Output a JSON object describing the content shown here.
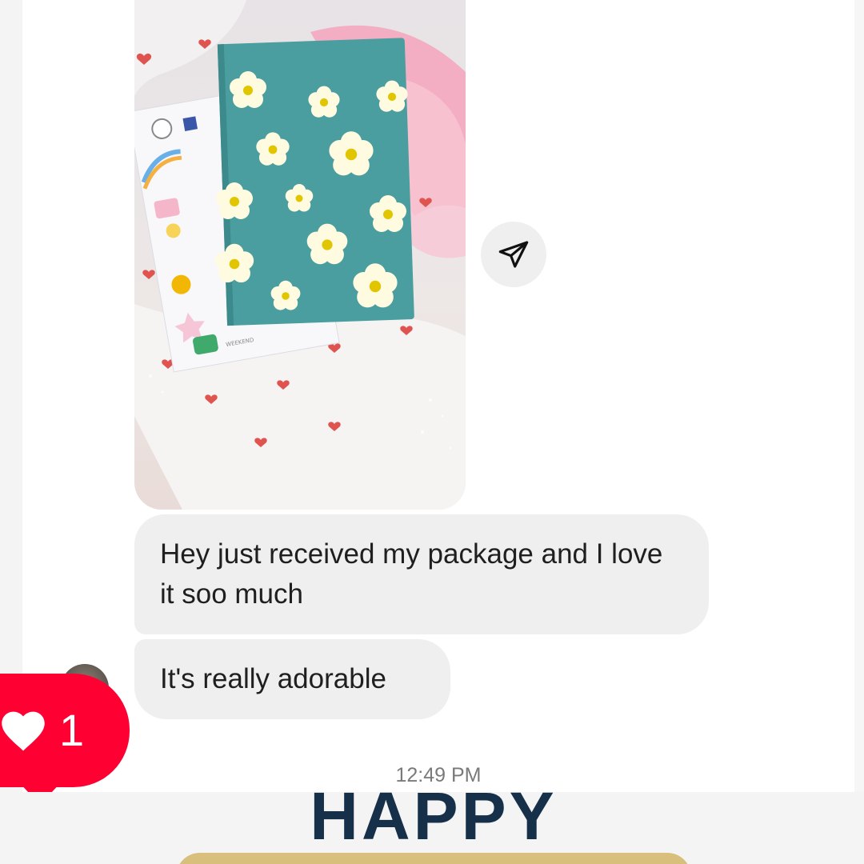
{
  "messages": [
    {
      "text": "Hey just received my package and I love it soo much"
    },
    {
      "text": "It's really adorable"
    }
  ],
  "timestamp": "12:49 PM",
  "like_notification": {
    "count": "1",
    "icon": "heart-icon",
    "color": "#ff0033"
  },
  "share_button": {
    "icon": "paper-plane-icon"
  },
  "overlay": {
    "headline": "HAPPY"
  },
  "photo": {
    "description_icons": [
      "notebook-image",
      "sticker-sheet"
    ],
    "notebook_color": "#4a9e9f",
    "flower_color": "#fffbe0",
    "flower_center_color": "#e0c500"
  }
}
